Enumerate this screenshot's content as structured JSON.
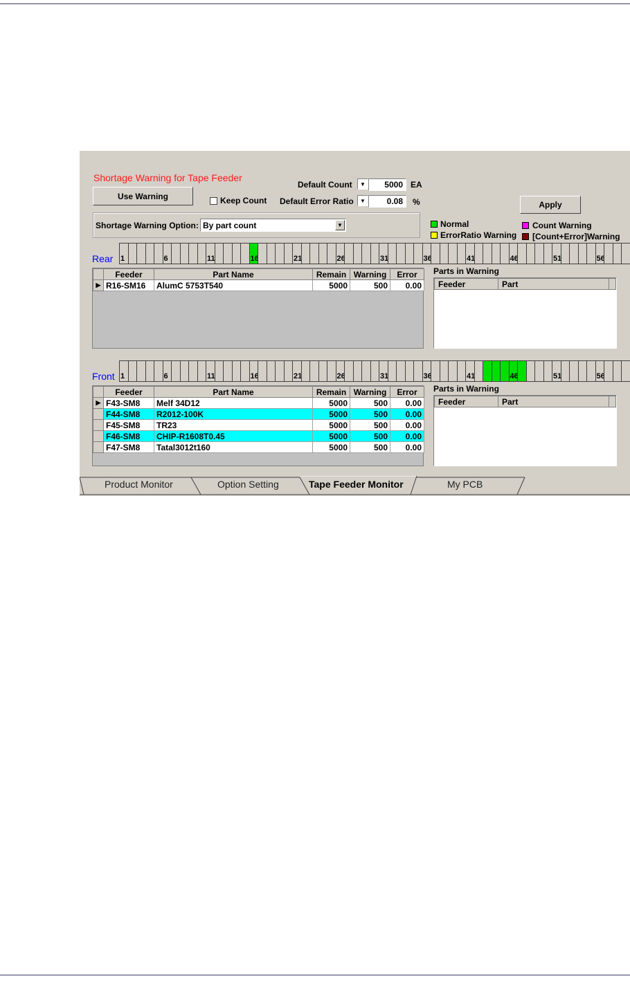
{
  "title": "Shortage Warning for Tape Feeder",
  "use_warning_label": "Use Warning",
  "keep_count_label": "Keep Count",
  "default_count": {
    "label": "Default Count",
    "value": "5000",
    "unit": "EA"
  },
  "default_error_ratio": {
    "label": "Default Error Ratio",
    "value": "0.08",
    "unit": "%"
  },
  "apply_label": "Apply",
  "option": {
    "label": "Shortage Warning Option:",
    "value": "By part count"
  },
  "legend": {
    "normal": "Normal",
    "normal_color": "#00e000",
    "error_ratio": "ErrorRatio Warning",
    "error_ratio_color": "#ffff00",
    "count": "Count Warning",
    "count_color": "#ff00ff",
    "count_error": "[Count+Error]Warning",
    "count_error_color": "#800000"
  },
  "strip_numbers": [
    "1",
    "6",
    "11",
    "16",
    "21",
    "26",
    "31",
    "36",
    "41",
    "46",
    "51",
    "56"
  ],
  "rear": {
    "label": "Rear",
    "active_slots": [
      16
    ],
    "columns": [
      "Feeder",
      "Part Name",
      "Remain",
      "Warning",
      "Error"
    ],
    "rows": [
      {
        "feeder": "R16-SM16",
        "part": "AlumC 5753T540",
        "remain": "5000",
        "warning": "500",
        "error": "0.00",
        "current": true
      }
    ],
    "parts_in_warning": {
      "title": "Parts in Warning",
      "columns": [
        "Feeder",
        "Part"
      ]
    }
  },
  "front": {
    "label": "Front",
    "active_slots": [
      43,
      44,
      45,
      46,
      47
    ],
    "columns": [
      "Feeder",
      "Part Name",
      "Remain",
      "Warning",
      "Error"
    ],
    "rows": [
      {
        "feeder": "F43-SM8",
        "part": "Melf 34D12",
        "remain": "5000",
        "warning": "500",
        "error": "0.00",
        "current": true
      },
      {
        "feeder": "F44-SM8",
        "part": "R2012-100K",
        "remain": "5000",
        "warning": "500",
        "error": "0.00",
        "highlight": true
      },
      {
        "feeder": "F45-SM8",
        "part": "TR23",
        "remain": "5000",
        "warning": "500",
        "error": "0.00"
      },
      {
        "feeder": "F46-SM8",
        "part": "CHIP-R1608T0.45",
        "remain": "5000",
        "warning": "500",
        "error": "0.00",
        "highlight": true
      },
      {
        "feeder": "F47-SM8",
        "part": "Tatal3012t160",
        "remain": "5000",
        "warning": "500",
        "error": "0.00"
      }
    ],
    "parts_in_warning": {
      "title": "Parts in Warning",
      "columns": [
        "Feeder",
        "Part"
      ]
    }
  },
  "tabs": [
    "Product Monitor",
    "Option Setting",
    "Tape Feeder Monitor",
    "My PCB"
  ],
  "active_tab": "Tape Feeder Monitor"
}
